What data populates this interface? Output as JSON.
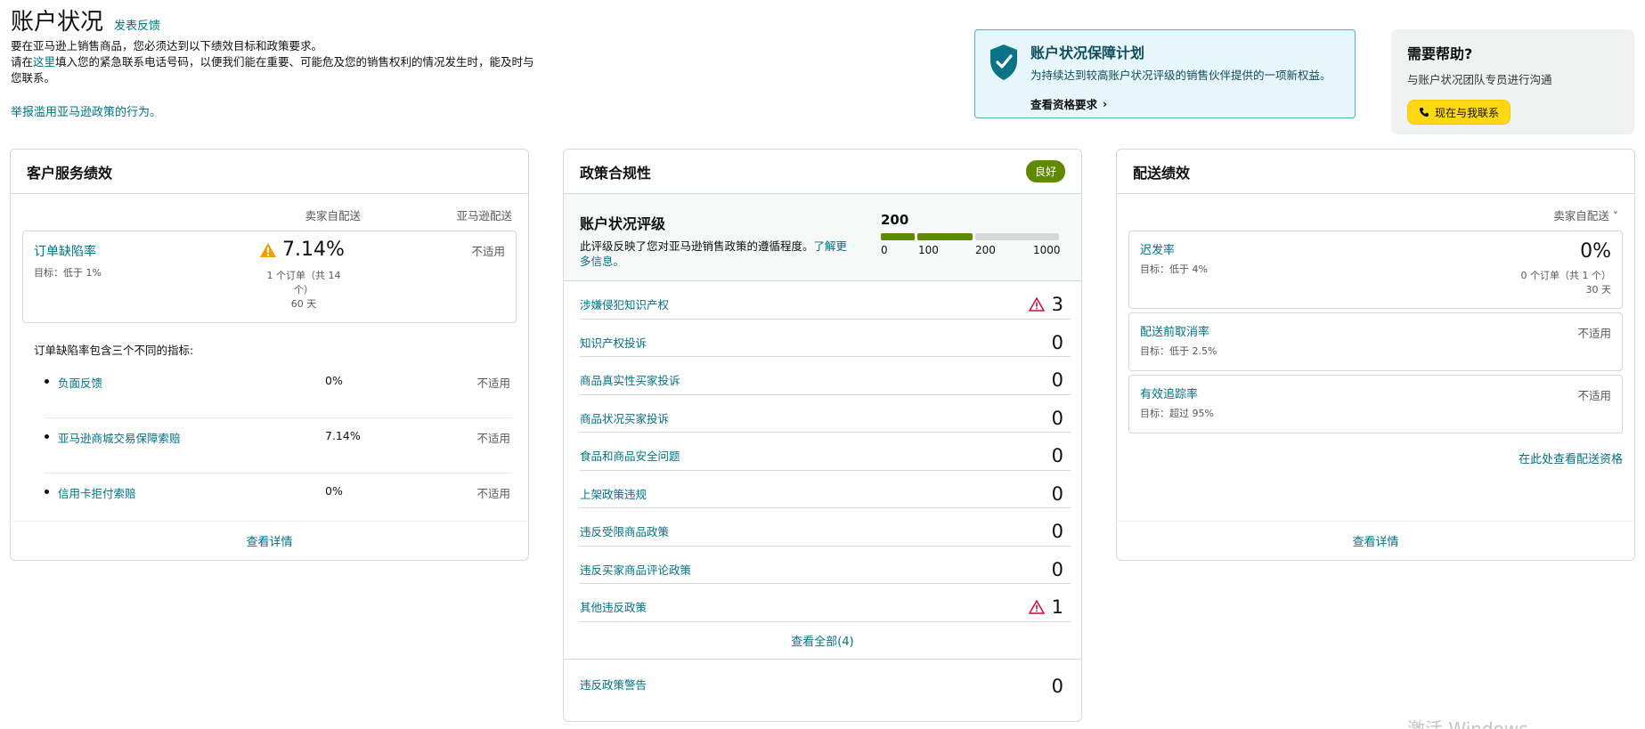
{
  "header": {
    "title": "账户状况",
    "feedback": "发表反馈",
    "intro_line1": "要在亚马逊上销售商品，您必须达到以下绩效目标和政策要求。",
    "intro_line2_pre": "请在",
    "intro_line2_link": "这里",
    "intro_line2_post": "填入您的紧急联系电话号码，以便我们能在重要、可能危及您的销售权利的情况发生时，能及时与您联系。",
    "report_link": "举报滥用亚马逊政策的行为。"
  },
  "plan": {
    "title": "账户状况保障计划",
    "subtitle": "为持续达到较高账户状况评级的销售伙伴提供的一项新权益。",
    "link": "查看资格要求",
    "icon": "shield-check-icon",
    "color": "#0a7385"
  },
  "help": {
    "title": "需要帮助?",
    "subtitle": "与账户状况团队专员进行沟通",
    "button": "现在与我联系"
  },
  "customer_service": {
    "title": "客户服务绩效",
    "col_seller": "卖家自配送",
    "col_amazon": "亚马逊配送",
    "odr": {
      "name": "订单缺陷率",
      "target": "目标：低于 1%",
      "value": "7.14%",
      "detail": "1 个订单（共 14 个）",
      "days": "60 天",
      "amazon": "不适用"
    },
    "note": "订单缺陷率包含三个不同的指标:",
    "items": [
      {
        "name": "负面反馈",
        "value": "0%",
        "amazon": "不适用"
      },
      {
        "name": "亚马逊商城交易保障索赔",
        "value": "7.14%",
        "amazon": "不适用"
      },
      {
        "name": "信用卡拒付索赔",
        "value": "0%",
        "amazon": "不适用"
      }
    ],
    "footer": "查看详情"
  },
  "policy": {
    "title": "政策合规性",
    "badge": "良好",
    "badge_color": "#5f8a00",
    "ahr": {
      "title": "账户状况评级",
      "desc": "此评级反映了您对亚马逊销售政策的遵循程度。",
      "desc_link": "了解更多信息。",
      "score": "200",
      "score_value": 200,
      "tick_labels": [
        "0",
        "100",
        "200",
        "1000"
      ]
    },
    "items": [
      {
        "name": "涉嫌侵犯知识产权",
        "count": "3",
        "warn": true
      },
      {
        "name": "知识产权投诉",
        "count": "0",
        "warn": false
      },
      {
        "name": "商品真实性买家投诉",
        "count": "0",
        "warn": false
      },
      {
        "name": "商品状况买家投诉",
        "count": "0",
        "warn": false
      },
      {
        "name": "食品和商品安全问题",
        "count": "0",
        "warn": false
      },
      {
        "name": "上架政策违规",
        "count": "0",
        "warn": false
      },
      {
        "name": "违反受限商品政策",
        "count": "0",
        "warn": false
      },
      {
        "name": "违反买家商品评论政策",
        "count": "0",
        "warn": false
      },
      {
        "name": "其他违反政策",
        "count": "1",
        "warn": true
      }
    ],
    "footer": "查看全部(4)",
    "warnings": {
      "name": "违反政策警告",
      "count": "0"
    }
  },
  "shipping": {
    "title": "配送绩效",
    "filter": "卖家自配送",
    "late": {
      "name": "迟发率",
      "target": "目标：低于 4%",
      "value": "0%",
      "detail": "0 个订单（共 1 个）",
      "days": "30 天"
    },
    "cancel": {
      "name": "配送前取消率",
      "target": "目标：低于 2.5%",
      "value": "不适用"
    },
    "tracking": {
      "name": "有效追踪率",
      "target": "目标：超过 95%",
      "value": "不适用"
    },
    "eligibility_link": "在此处查看配送资格",
    "footer": "查看详情"
  },
  "watermark": "激活 Windows"
}
